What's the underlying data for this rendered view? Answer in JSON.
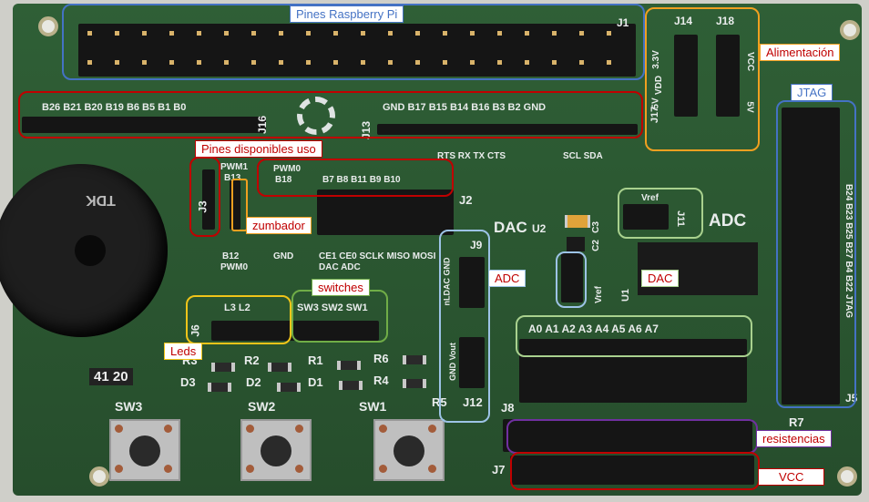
{
  "annotations": {
    "pines_raspberry": "Pines Raspberry Pi",
    "alimentacion": "Alimentación",
    "jtag": "JTAG",
    "pines_disponibles": "Pines disponibles uso",
    "zumbador": "zumbador",
    "switches": "switches",
    "leds": "Leds",
    "adc": "ADC",
    "dac": "DAC",
    "resistencias": "resistencias",
    "vcc": "VCC"
  },
  "colors": {
    "blue": "#4472c4",
    "orange": "#f0a020",
    "red": "#c00000",
    "green": "#70ad47",
    "lightgreen": "#a9d18e",
    "lightblue": "#9dc3e6",
    "purple": "#7030a0"
  },
  "silk": {
    "j1": "J1",
    "j14": "J14",
    "j18": "J18",
    "j17": "J17",
    "v33": "3.3V",
    "vdd": "VDD",
    "v5": "5V",
    "vcc": "VCC",
    "gpio_row": "B26 B21 B20 B19 B6  B5  B1  B0",
    "j16": "J16",
    "j13": "J13",
    "mid_row": "GND B17       B15 B14 B16     B3  B2  GND",
    "uart": "RTS   RX  TX  CTS",
    "i2c": "SCL SDA",
    "j3": "J3",
    "pwm1": "PWM1",
    "b13": "B13",
    "pwm0_top": "PWM0",
    "b18": "B18",
    "spi_row": "B7  B8  B11 B9  B10",
    "j2": "J2",
    "b12": "B12",
    "pwm0_bot": "PWM0",
    "gnd": "GND",
    "spi_labels": "CE1 CE0 SCLK MISO MOSI",
    "spi_labels2": "DAC ADC",
    "dac_title": "DAC",
    "u2": "U2",
    "c2": "C2",
    "c3": "C3",
    "vref": "Vref",
    "j11": "J11",
    "adc_title": "ADC",
    "j9": "J9",
    "nldac": "nLDAC GND",
    "u1": "U1",
    "vref2": "Vref",
    "jtag_pins": "B24 B23 B25 B27 B4 B22 JTAG",
    "j5": "J5",
    "leds_row": "L3  L2",
    "sw_row": "SW3 SW2 SW1",
    "j6": "J6",
    "analog_row": "A0  A1  A2  A3  A4  A5  A6  A7",
    "gnd_vout": "GND Vout",
    "j12": "J12",
    "r3": "R3",
    "r2": "R2",
    "r1": "R1",
    "r6": "R6",
    "r4": "R4",
    "r5": "R5",
    "d3": "D3",
    "d2": "D2",
    "d1": "D1",
    "sw3": "SW3",
    "sw2": "SW2",
    "sw1": "SW1",
    "j8": "J8",
    "j7": "J7",
    "r7": "R7",
    "board_num": "41 20",
    "tdk": "TDK"
  }
}
